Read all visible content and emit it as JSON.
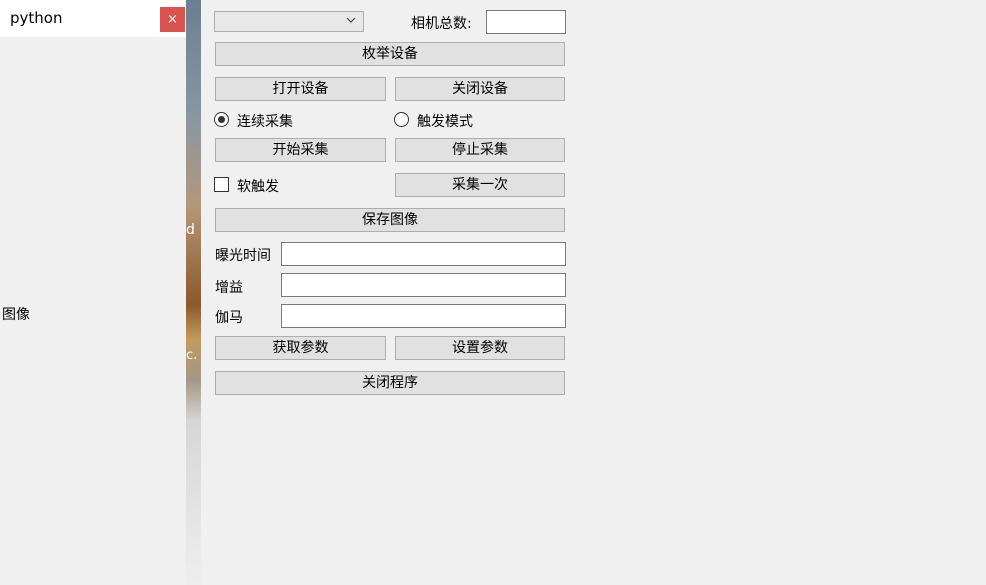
{
  "python_window": {
    "title": "python",
    "close_glyph": "×",
    "image_label": "图像"
  },
  "background": {
    "fragment_d": "d",
    "fragment_c": "c."
  },
  "controls": {
    "device_select": {
      "selected": ""
    },
    "camera_count_label": "相机总数:",
    "camera_count_value": "",
    "enum_devices": "枚举设备",
    "open_device": "打开设备",
    "close_device": "关闭设备",
    "continuous_mode": {
      "label": "连续采集",
      "checked": true
    },
    "trigger_mode": {
      "label": "触发模式",
      "checked": false
    },
    "start_grab": "开始采集",
    "stop_grab": "停止采集",
    "software_trigger": {
      "label": "软触发",
      "checked": false
    },
    "trigger_once": "采集一次",
    "save_image": "保存图像",
    "exposure_label": "曝光时间",
    "exposure_value": "",
    "gain_label": "增益",
    "gain_value": "",
    "gamma_label": "伽马",
    "gamma_value": "",
    "get_params": "获取参数",
    "set_params": "设置参数",
    "close_program": "关闭程序"
  }
}
